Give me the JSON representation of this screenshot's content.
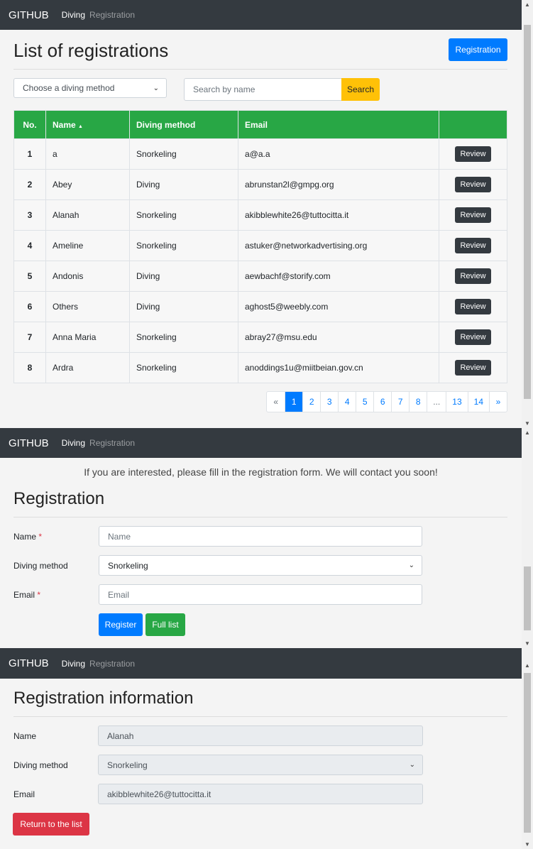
{
  "nav": {
    "brand": "GITHUB",
    "diving": "Diving",
    "registration": "Registration"
  },
  "list": {
    "title": "List of registrations",
    "registration_button": "Registration",
    "filter_placeholder": "Choose a diving method",
    "search_placeholder": "Search by name",
    "search_button": "Search",
    "columns": [
      "No.",
      "Name",
      "Diving method",
      "Email",
      ""
    ],
    "sort_indicator": "▲",
    "rows": [
      {
        "no": "1",
        "name": "a",
        "method": "Snorkeling",
        "email": "a@a.a"
      },
      {
        "no": "2",
        "name": "Abey",
        "method": "Diving",
        "email": "abrunstan2l@gmpg.org"
      },
      {
        "no": "3",
        "name": "Alanah",
        "method": "Snorkeling",
        "email": "akibblewhite26@tuttocitta.it"
      },
      {
        "no": "4",
        "name": "Ameline",
        "method": "Snorkeling",
        "email": "astuker@networkadvertising.org"
      },
      {
        "no": "5",
        "name": "Andonis",
        "method": "Diving",
        "email": "aewbachf@storify.com"
      },
      {
        "no": "6",
        "name": "Others",
        "method": "Diving",
        "email": "aghost5@weebly.com"
      },
      {
        "no": "7",
        "name": "Anna Maria",
        "method": "Snorkeling",
        "email": "abray27@msu.edu"
      },
      {
        "no": "8",
        "name": "Ardra",
        "method": "Snorkeling",
        "email": "anoddings1u@miitbeian.gov.cn"
      }
    ],
    "review_label": "Review",
    "pagination": [
      "«",
      "1",
      "2",
      "3",
      "4",
      "5",
      "6",
      "7",
      "8",
      "...",
      "13",
      "14",
      "»"
    ],
    "current_page": "1"
  },
  "form": {
    "intro": "If you are interested, please fill in the registration form. We will contact you soon!",
    "title": "Registration",
    "name_label": "Name",
    "required_mark": "*",
    "name_placeholder": "Name",
    "method_label": "Diving method",
    "method_value": "Snorkeling",
    "email_label": "Email",
    "email_placeholder": "Email",
    "register_button": "Register",
    "full_list_button": "Full list"
  },
  "info": {
    "title": "Registration information",
    "name_label": "Name",
    "name_value": "Alanah",
    "method_label": "Diving method",
    "method_value": "Snorkeling",
    "email_label": "Email",
    "email_value": "akibblewhite26@tuttocitta.it",
    "return_button": "Return to the list"
  },
  "colors": {
    "navbar": "#343a40",
    "primary": "#007bff",
    "success": "#28a745",
    "warning": "#ffc107",
    "danger": "#dc3545"
  }
}
